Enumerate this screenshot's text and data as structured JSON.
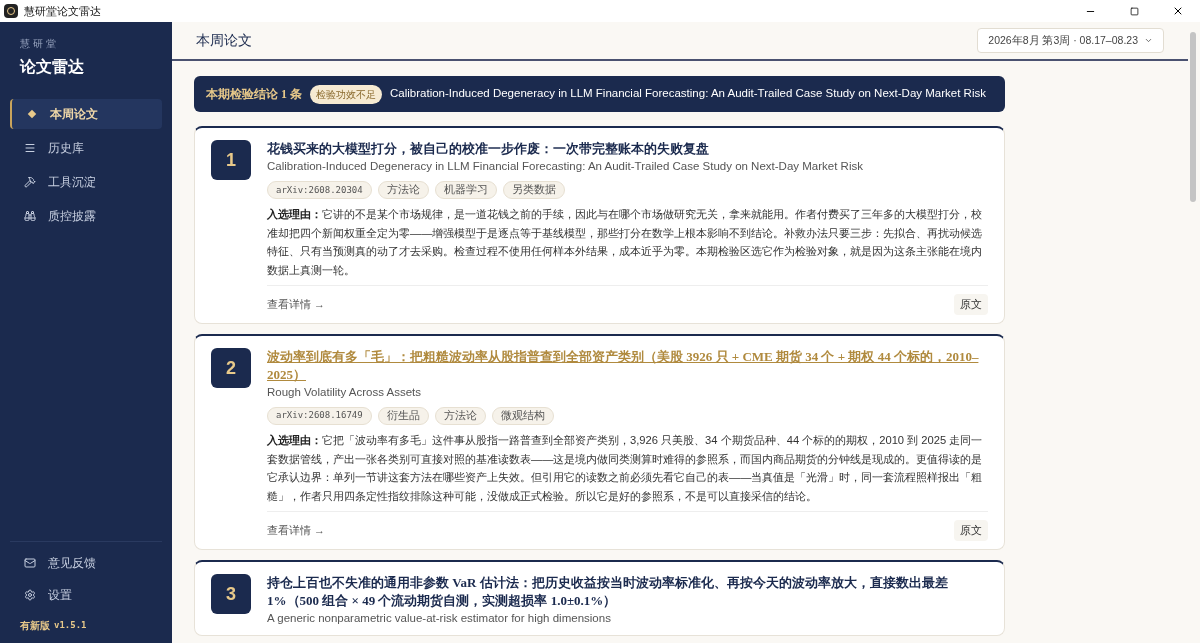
{
  "window": {
    "title": "慧研堂论文雷达"
  },
  "sidebar": {
    "brand_small": "慧 研 堂",
    "brand": "论文雷达",
    "items": [
      {
        "label": "本周论文",
        "kind": "star",
        "selected": true
      },
      {
        "label": "历史库",
        "kind": "list",
        "selected": false
      },
      {
        "label": "工具沉淀",
        "kind": "tools",
        "selected": false
      },
      {
        "label": "质控披露",
        "kind": "binoculars",
        "selected": false
      }
    ],
    "footer_items": [
      {
        "label": "意见反馈",
        "kind": "mail"
      },
      {
        "label": "设置",
        "kind": "settings"
      }
    ],
    "update_label": "有新版",
    "version": "v1.5.1"
  },
  "header": {
    "title": "本周论文",
    "week_select": "2026年8月 第3周 · 08.17–08.23"
  },
  "banner": {
    "label": "本期检验结论 1 条",
    "badge": "检验功效不足",
    "paper": "Calibration-Induced Degeneracy in LLM Financial Forecasting: An Audit-Trailed Case Study on Next-Day Market Risk"
  },
  "papers": [
    {
      "rank": "1",
      "highlighted": false,
      "title": "花钱买来的大模型打分，被自己的校准一步作废：一次带完整账本的失败复盘",
      "subtitle": "Calibration-Induced Degeneracy in LLM Financial Forecasting: An Audit-Trailed Case Study on Next-Day Market Risk",
      "tags": [
        {
          "kind": "id",
          "label": "arXiv:2608.20304"
        },
        {
          "kind": "topic",
          "label": "方法论"
        },
        {
          "kind": "topic",
          "label": "机器学习"
        },
        {
          "kind": "topic",
          "label": "另类数据"
        }
      ],
      "reason_label": "入选理由：",
      "reason": "它讲的不是某个市场规律，是一道花钱之前的手续，因此与在哪个市场做研究无关，拿来就能用。作者付费买了三年多的大模型打分，校准却把四个新闻权重全定为零——增强模型于是逐点等于基线模型，那些打分在数学上根本影响不到结论。补救办法只要三步：先拟合、再扰动候选特征、只有当预测真的动了才去采购。检查过程不使用任何样本外结果，成本近乎为零。本期检验区选它作为检验对象，就是因为这条主张能在境内数据上真测一轮。",
      "details": "查看详情 →",
      "source": "原文"
    },
    {
      "rank": "2",
      "highlighted": true,
      "title": "波动率到底有多「毛」：把粗糙波动率从股指普查到全部资产类别（美股 3926 只 + CME 期货 34 个 + 期权 44 个标的，2010–2025）",
      "subtitle": "Rough Volatility Across Assets",
      "tags": [
        {
          "kind": "id",
          "label": "arXiv:2608.16749"
        },
        {
          "kind": "topic",
          "label": "衍生品"
        },
        {
          "kind": "topic",
          "label": "方法论"
        },
        {
          "kind": "topic",
          "label": "微观结构"
        }
      ],
      "reason_label": "入选理由：",
      "reason": "它把「波动率有多毛」这件事从股指一路普查到全部资产类别，3,926 只美股、34 个期货品种、44 个标的的期权，2010 到 2025 走同一套数据管线，产出一张各类别可直接对照的基准读数表——这是境内做同类测算时难得的参照系，而国内商品期货的分钟线是现成的。更值得读的是它承认边界：单列一节讲这套方法在哪些资产上失效。但引用它的读数之前必须先看它自己的表——当真值是「光滑」时，同一套流程照样报出「粗糙」，作者只用四条定性指纹排除这种可能，没做成正式检验。所以它是好的参照系，不是可以直接采信的结论。",
      "details": "查看详情 →",
      "source": "原文"
    },
    {
      "rank": "3",
      "highlighted": false,
      "title": "持仓上百也不失准的通用非参数 VaR 估计法：把历史收益按当时波动率标准化、再按今天的波动率放大，直接数出最差 1%（500 组合 × 49 个流动期货自测，实测超损率 1.0±0.1%）",
      "subtitle": "A generic nonparametric value-at-risk estimator for high dimensions"
    }
  ]
}
